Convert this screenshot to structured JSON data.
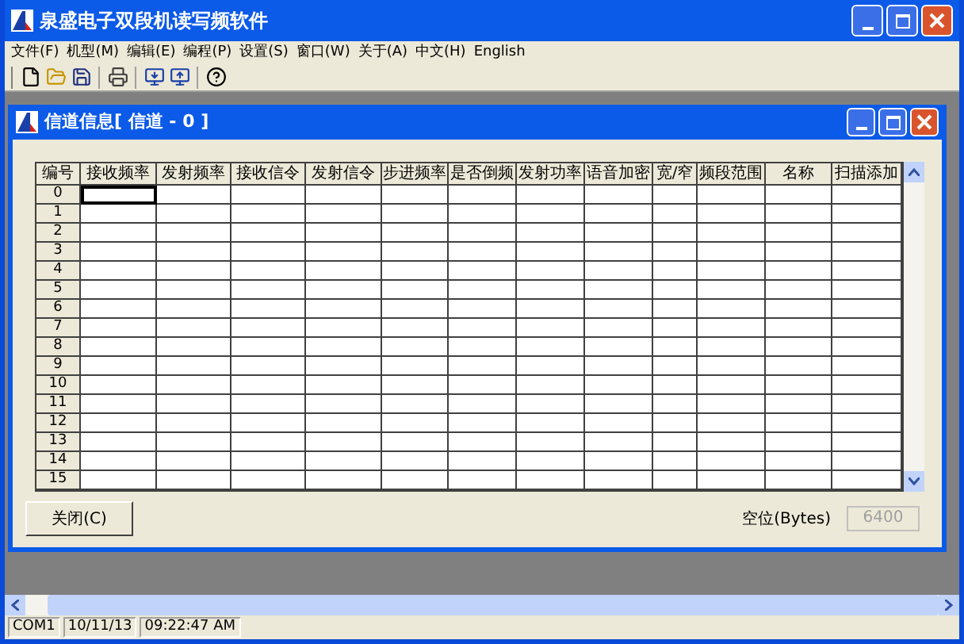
{
  "window": {
    "title": "泉盛电子双段机读写频软件"
  },
  "menu": [
    "文件(F)",
    "机型(M)",
    "编辑(E)",
    "编程(P)",
    "设置(S)",
    "窗口(W)",
    "关于(A)",
    "中文(H)",
    "English"
  ],
  "toolbar": [
    {
      "kind": "new"
    },
    {
      "kind": "open"
    },
    {
      "kind": "save"
    },
    {
      "kind": "sep"
    },
    {
      "kind": "print"
    },
    {
      "kind": "sep"
    },
    {
      "kind": "read"
    },
    {
      "kind": "write"
    },
    {
      "kind": "sep"
    },
    {
      "kind": "help"
    }
  ],
  "child_window": {
    "title": "信道信息[ 信道 - 0 ]",
    "table": {
      "columns": [
        "编号",
        "接收频率",
        "发射频率",
        "接收信令",
        "发射信令",
        "步进频率",
        "是否倒频",
        "发射功率",
        "语音加密",
        "宽/窄",
        "频段范围",
        "名称",
        "扫描添加"
      ],
      "rows": [
        {
          "number": "0",
          "selected": true
        },
        {
          "number": "1",
          "selected": false
        },
        {
          "number": "2",
          "selected": false
        },
        {
          "number": "3",
          "selected": false
        },
        {
          "number": "4",
          "selected": false
        },
        {
          "number": "5",
          "selected": false
        },
        {
          "number": "6",
          "selected": false
        },
        {
          "number": "7",
          "selected": false
        },
        {
          "number": "8",
          "selected": false
        },
        {
          "number": "9",
          "selected": false
        },
        {
          "number": "10",
          "selected": false
        },
        {
          "number": "11",
          "selected": false
        },
        {
          "number": "12",
          "selected": false
        },
        {
          "number": "13",
          "selected": false
        },
        {
          "number": "14",
          "selected": false
        },
        {
          "number": "15",
          "selected": false
        }
      ]
    },
    "close_button": "关闭(C)",
    "free_space": {
      "label": "空位(Bytes)",
      "value": "6400",
      "disabled": true
    }
  },
  "status_bar": [
    "COM1",
    "10/11/13",
    "09:22:47 AM"
  ]
}
